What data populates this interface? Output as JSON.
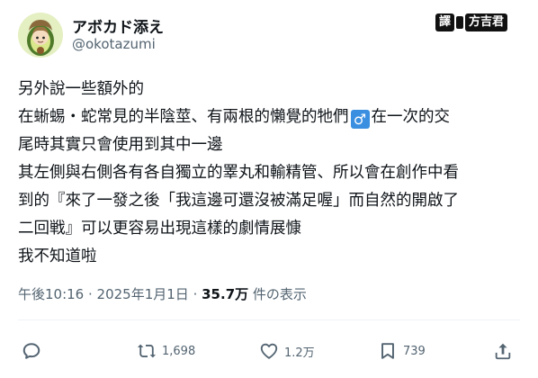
{
  "author": {
    "display_name": "アボカド添え",
    "handle": "@okotazumi"
  },
  "watermark": {
    "left_text": "譯",
    "right_text": "方吉君"
  },
  "post": {
    "lines": [
      "另外說一些額外的",
      "在蜥蜴・蛇常見的半陰莖、有兩根的懶覺的牠們",
      "在一次的交",
      "尾時其實只會使用到其中一邊",
      "其左側與右側各有各自獨立的睪丸和輸精管、所以會在創作中看",
      "到的『來了一發之後「我這邊可還沒被滿足喔」而自然的開啟了",
      "二回戦』可以更容易出現這樣的劇情展慷",
      "我不知道啦"
    ],
    "emoji": "♂"
  },
  "meta": {
    "time": "午後10:16",
    "separator1": " · ",
    "date": "2025年1月1日",
    "separator2": " · ",
    "views": "35.7万",
    "views_label": " 件の表示"
  },
  "actions": {
    "reply_icon": "reply-icon",
    "retweet_count": "1,698",
    "like_count": "1.2万",
    "bookmark_count": "739",
    "share_icon": "share-icon"
  },
  "colors": {
    "text": "#0f1419",
    "muted": "#536471",
    "divider": "#eff3f4",
    "emoji_badge": "#3b8fe0"
  }
}
